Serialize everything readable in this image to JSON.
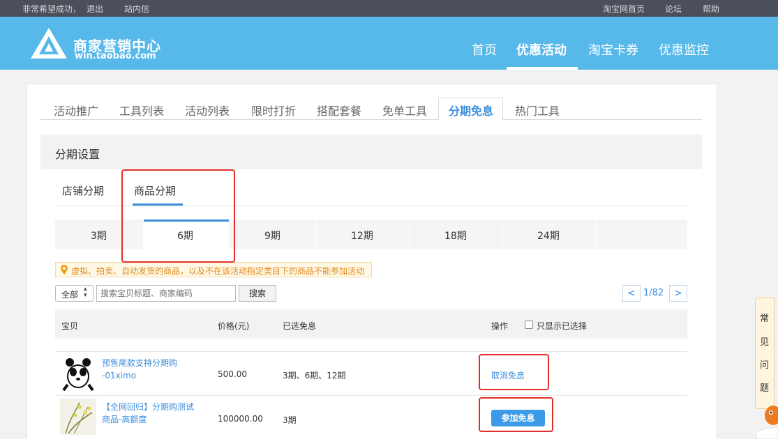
{
  "topbar": {
    "user_link": "非常希望成功，",
    "logout": "退出",
    "messages": "站内信",
    "taobao_home": "淘宝网首页",
    "forum": "论坛",
    "help": "帮助"
  },
  "header": {
    "logo_title": "商家营销中心",
    "logo_sub": "win.taobao.com",
    "nav": [
      "首页",
      "优惠活动",
      "淘宝卡券",
      "优惠监控"
    ],
    "active_nav": "优惠活动"
  },
  "main_tabs": [
    "活动推广",
    "工具列表",
    "活动列表",
    "限时打折",
    "搭配套餐",
    "免单工具",
    "分期免息",
    "热门工具"
  ],
  "active_main_tab": "分期免息",
  "section_title": "分期设置",
  "sub_tabs": [
    "店铺分期",
    "商品分期"
  ],
  "active_sub_tab": "商品分期",
  "periods": [
    "3期",
    "6期",
    "9期",
    "12期",
    "18期",
    "24期"
  ],
  "active_period": "6期",
  "notice": "虚拟、拍卖、自动发货的商品，以及不在该活动指定类目下的商品不能参加活动",
  "filter": {
    "select_value": "全部",
    "search_placeholder": "搜索宝贝标题、商家编码",
    "search_button": "搜索"
  },
  "pager": {
    "text": "1/82",
    "prev": "<",
    "next": ">"
  },
  "table": {
    "headers": {
      "item": "宝贝",
      "price": "价格(元)",
      "selected": "已选免息",
      "action": "操作",
      "only_selected": "只显示已选择"
    },
    "rows": [
      {
        "name": "预售尾款支持分期购 -01ximo",
        "price": "500.00",
        "selected": "3期、6期、12期",
        "action": "取消免息",
        "thumb_icon": "panda-image"
      },
      {
        "name": "【全网回归】分期购测试商品-高额度",
        "price": "100000.00",
        "selected": "3期",
        "action": "参加免息",
        "thumb_icon": "orchid-image"
      }
    ]
  },
  "faq": [
    "常",
    "见",
    "问",
    "题"
  ],
  "colors": {
    "header": "#57b8ea",
    "topbar": "#4b4f5a",
    "accent": "#3c8ede",
    "highlight": "#e0302b"
  }
}
